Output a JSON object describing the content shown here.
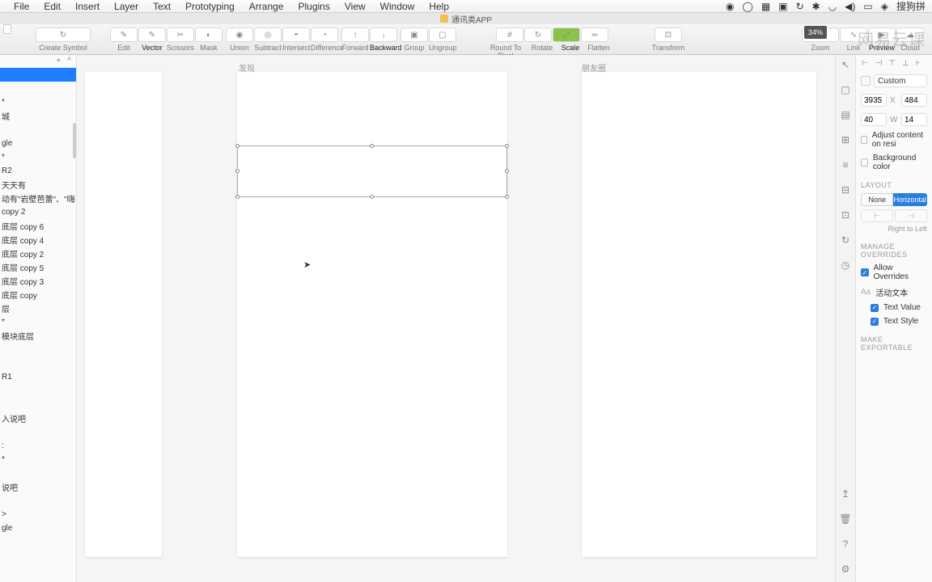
{
  "menubar": {
    "items": [
      "File",
      "Edit",
      "Insert",
      "Layer",
      "Text",
      "Prototyping",
      "Arrange",
      "Plugins",
      "View",
      "Window",
      "Help"
    ],
    "search": "搜狗拼"
  },
  "titlebar": {
    "title": "通讯类APP"
  },
  "toolbar": {
    "createSymbol": "Create Symbol",
    "edit": "Edit",
    "vector": "Vector",
    "scissors": "Scissors",
    "mask": "Mask",
    "union": "Union",
    "subtract": "Subtract",
    "intersect": "Intersect",
    "difference": "Difference",
    "forward": "Forward",
    "backward": "Backward",
    "group": "Group",
    "ungroup": "Ungroup",
    "roundToPixel": "Round To Pixel",
    "rotate": "Rotate",
    "scale": "Scale",
    "flatten": "Flatten",
    "transform": "Transform",
    "zoom": "Zoom",
    "link": "Link",
    "preview": "Preview",
    "cloud": "Cloud",
    "zoomValue": "34%"
  },
  "layers": {
    "items": [
      "",
      "",
      "*",
      "城",
      "",
      "gle",
      "*",
      "R2",
      "天天有",
      "动有\"岩壁芭蕾\"、\"嗨…",
      "copy 2",
      "底层 copy 6",
      "底层 copy 4",
      "底层 copy 2",
      "底层 copy 5",
      "底层 copy 3",
      "底层 copy",
      "层",
      "*",
      "模块底层",
      "",
      "",
      "R1",
      "",
      "",
      "入说吧",
      "",
      ":",
      "*",
      "",
      "说吧",
      "",
      ">",
      "gle"
    ],
    "selectedIndex": 0
  },
  "canvas": {
    "artboard1": "发现",
    "artboard2": "朋友圈"
  },
  "inspector": {
    "custom": "Custom",
    "x": "3935",
    "xLabel": "X",
    "y": "484",
    "w": "40",
    "wLabel": "W",
    "h": "14",
    "adjustContent": "Adjust content on resi",
    "bgColor": "Background color",
    "layout": "LAYOUT",
    "layoutNone": "None",
    "layoutHorizontal": "Horizontal",
    "rtl": "Right to Left",
    "manageOverrides": "MANAGE OVERRIDES",
    "allowOverrides": "Allow Overrides",
    "activeText": "活动文本",
    "textValue": "Text Value",
    "textStyle": "Text Style",
    "makeExportable": "MAKE EXPORTABLE"
  },
  "watermark": "网易云课"
}
